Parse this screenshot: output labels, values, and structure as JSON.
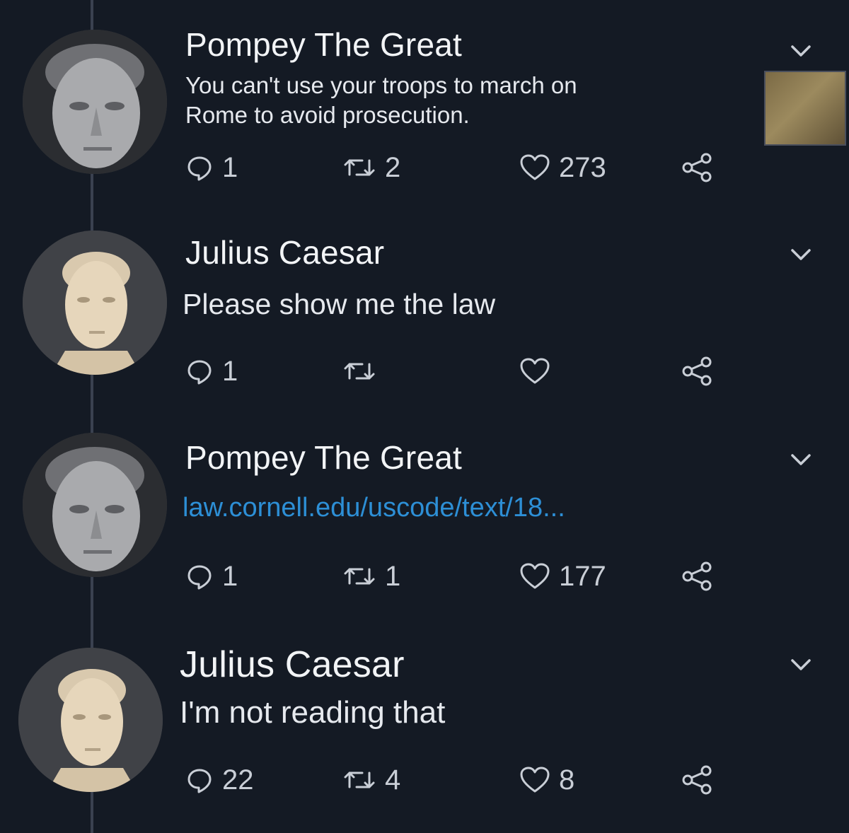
{
  "tweets": [
    {
      "author": "Pompey The Great",
      "avatar": "pompey",
      "text": "You can't use your troops to march on\nRome to avoid prosecution.",
      "replies": "1",
      "retweets": "2",
      "likes": "273"
    },
    {
      "author": "Julius Caesar",
      "avatar": "caesar",
      "text": "Please show me the law",
      "replies": "1",
      "retweets": "",
      "likes": ""
    },
    {
      "author": "Pompey The Great",
      "avatar": "pompey",
      "text": "law.cornell.edu/uscode/text/18...",
      "replies": "1",
      "retweets": "1",
      "likes": "177"
    },
    {
      "author": "Julius Caesar",
      "avatar": "caesar",
      "text": "I'm not reading that",
      "replies": "22",
      "retweets": "4",
      "likes": "8"
    }
  ],
  "icons": {
    "reply": "speech-bubble-icon",
    "retweet": "retweet-icon",
    "like": "heart-icon",
    "share": "share-icon",
    "menu": "chevron-down-icon"
  },
  "colors": {
    "background": "#141a24",
    "link": "#2d8fd6",
    "icon": "#c9ced6"
  }
}
